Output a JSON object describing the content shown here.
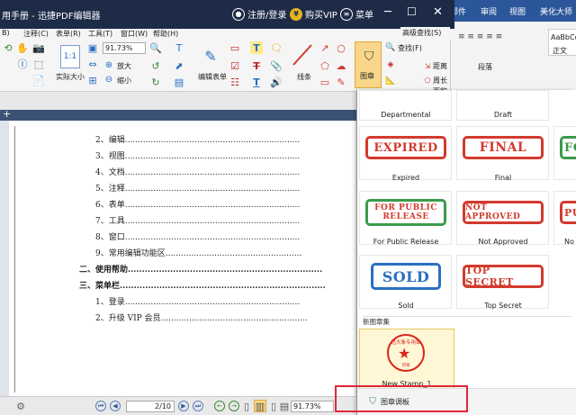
{
  "title_bar": {
    "title": "用手册 - 迅捷PDF编辑器",
    "login": "注册/登录",
    "vip": "购买VIP",
    "menu": "菜单"
  },
  "word_bar": {
    "tabs": [
      "邮件",
      "审阅",
      "视图",
      "美化大师"
    ]
  },
  "word_ribbon": {
    "style_preview": "AaBbCc",
    "style_name": "正文",
    "para_group": "段落"
  },
  "menu_bar": {
    "items": [
      "B)",
      "注释(C)",
      "表单(R)",
      "工具(T)",
      "窗口(W)",
      "帮助(H)"
    ]
  },
  "toolbar": {
    "zoom": "91.73%",
    "actual_size": "实际大小",
    "zoom_in": "放大",
    "zoom_out": "缩小",
    "edit_form": "编辑表单",
    "line": "线条",
    "stamp": "图章",
    "find": "查找(F)",
    "adv_find": "高级查找(S)",
    "distance": "距离",
    "perimeter": "周长",
    "area": "面积"
  },
  "document": {
    "lines": [
      {
        "text": "2、编辑....................................................................",
        "bold": false
      },
      {
        "text": "3、视图....................................................................",
        "bold": false
      },
      {
        "text": "4、文档....................................................................",
        "bold": false
      },
      {
        "text": "5、注释....................................................................",
        "bold": false
      },
      {
        "text": "6、表单....................................................................",
        "bold": false
      },
      {
        "text": "7、工具....................................................................",
        "bold": false
      },
      {
        "text": "8、窗口....................................................................",
        "bold": false
      },
      {
        "text": "9、常用编辑功能区.....................................................",
        "bold": false
      },
      {
        "text": "二、使用帮助.....................................................................",
        "bold": true
      },
      {
        "text": "三、菜单栏.........................................................................",
        "bold": true
      },
      {
        "text": "1、登录....................................................................",
        "bold": false
      },
      {
        "text": "2、升级 VIP 会员.........................................................",
        "bold": false
      }
    ]
  },
  "status_bar": {
    "page": "2/10",
    "zoom": "91.73%"
  },
  "stamp_panel": {
    "top_labels": [
      "Departmental",
      "Draft"
    ],
    "stamps": [
      {
        "text": "EXPIRED",
        "label": "Expired"
      },
      {
        "text": "FINAL",
        "label": "Final"
      },
      {
        "text": "FO",
        "label": ""
      },
      {
        "text": "FOR PUBLIC RELEASE",
        "label": "For Public Release"
      },
      {
        "text": "NOT APPROVED",
        "label": "Not Approved"
      },
      {
        "text": "PU",
        "label": "No"
      },
      {
        "text": "SOLD",
        "label": "Sold"
      },
      {
        "text": "TOP SECRET",
        "label": "Top Secret"
      }
    ],
    "new_section": "新图章集",
    "seal_text": "迅大象专用章",
    "seal_bottom": "印章",
    "new_stamp_label": "New Stamp_1",
    "palette_button": "图章调板"
  }
}
